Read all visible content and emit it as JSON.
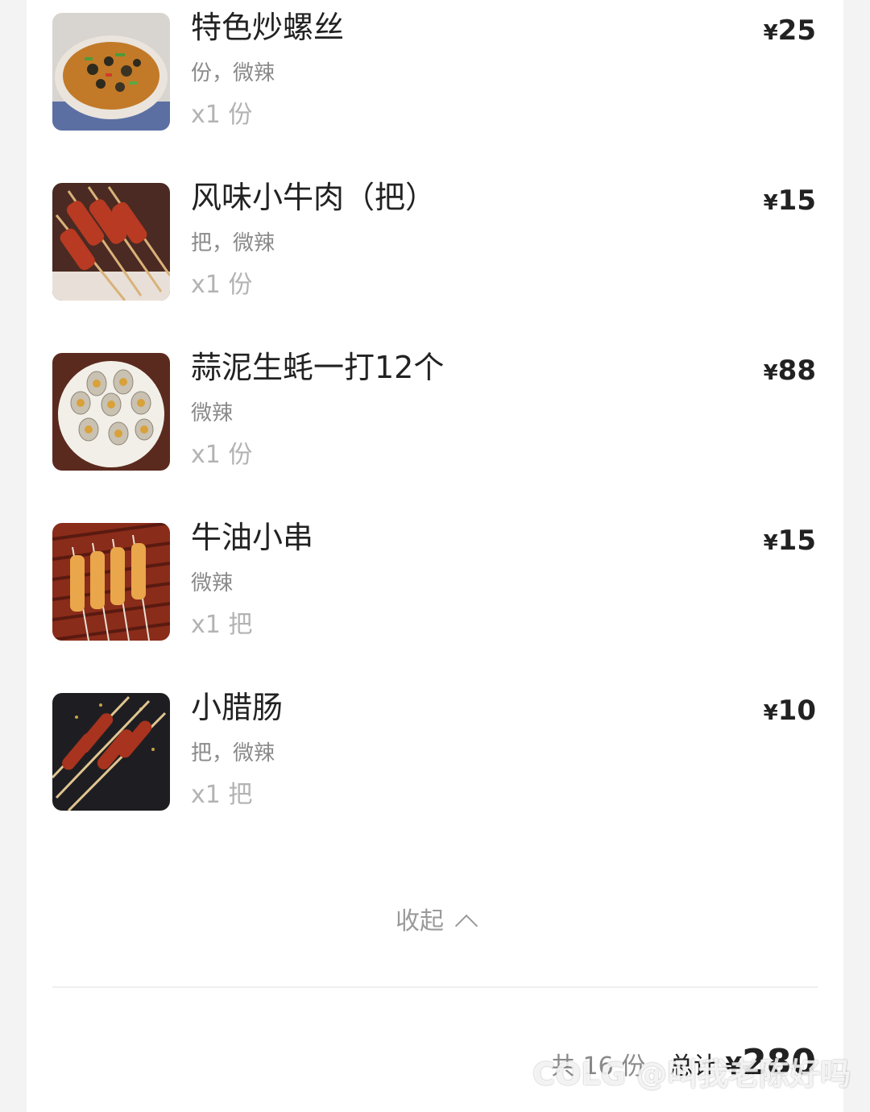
{
  "items": [
    {
      "name": "特色炒螺丝",
      "spec": "份，微辣",
      "qty": "x1 份",
      "price_symbol": "¥",
      "price": "25",
      "image_icon": "snail-dish-image"
    },
    {
      "name": "风味小牛肉（把）",
      "spec": "把，微辣",
      "qty": "x1 份",
      "price_symbol": "¥",
      "price": "15",
      "image_icon": "beef-skewers-image"
    },
    {
      "name": "蒜泥生蚝一打12个",
      "spec": "微辣",
      "qty": "x1 份",
      "price_symbol": "¥",
      "price": "88",
      "image_icon": "oysters-image"
    },
    {
      "name": "牛油小串",
      "spec": "微辣",
      "qty": "x1 把",
      "price_symbol": "¥",
      "price": "15",
      "image_icon": "tallow-skewers-image"
    },
    {
      "name": "小腊肠",
      "spec": "把，微辣",
      "qty": "x1 把",
      "price_symbol": "¥",
      "price": "10",
      "image_icon": "sausage-skewers-image"
    }
  ],
  "collapse": {
    "label": "收起"
  },
  "summary": {
    "count_label": "共 16 份",
    "total_label": "总计",
    "total_symbol": "¥",
    "total_value": "280"
  },
  "watermark": {
    "text": "COLG @叫我老陈好吗"
  }
}
